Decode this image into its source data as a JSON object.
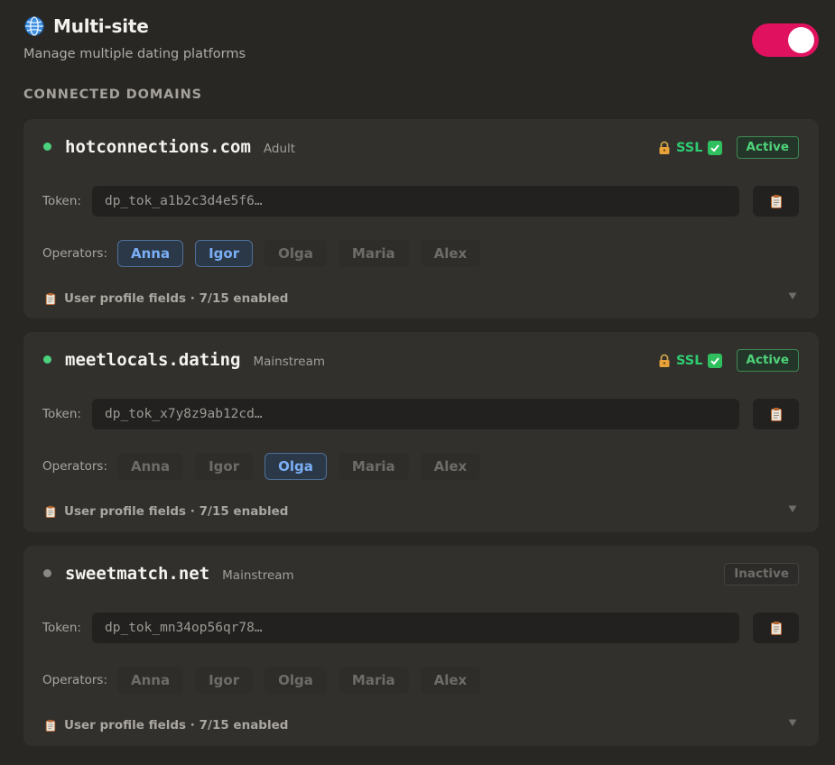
{
  "header": {
    "title": "Multi-site",
    "subtitle": "Manage multiple dating platforms",
    "toggle_on": true
  },
  "section_label": "CONNECTED DOMAINS",
  "domains": [
    {
      "name": "hotconnections.com",
      "category": "Adult",
      "ssl_label": "SSL",
      "ssl": true,
      "status": "Active",
      "token_label": "Token:",
      "token": "dp_tok_a1b2c3d4e5f6…",
      "operators_label": "Operators:",
      "operators": [
        {
          "name": "Anna",
          "selected": true
        },
        {
          "name": "Igor",
          "selected": true
        },
        {
          "name": "Olga",
          "selected": false
        },
        {
          "name": "Maria",
          "selected": false
        },
        {
          "name": "Alex",
          "selected": false
        }
      ],
      "profile_fields": "User profile fields · 7/15 enabled"
    },
    {
      "name": "meetlocals.dating",
      "category": "Mainstream",
      "ssl_label": "SSL",
      "ssl": true,
      "status": "Active",
      "token_label": "Token:",
      "token": "dp_tok_x7y8z9ab12cd…",
      "operators_label": "Operators:",
      "operators": [
        {
          "name": "Anna",
          "selected": false
        },
        {
          "name": "Igor",
          "selected": false
        },
        {
          "name": "Olga",
          "selected": true
        },
        {
          "name": "Maria",
          "selected": false
        },
        {
          "name": "Alex",
          "selected": false
        }
      ],
      "profile_fields": "User profile fields · 7/15 enabled"
    },
    {
      "name": "sweetmatch.net",
      "category": "Mainstream",
      "ssl_label": "",
      "ssl": false,
      "status": "Inactive",
      "token_label": "Token:",
      "token": "dp_tok_mn34op56qr78…",
      "operators_label": "Operators:",
      "operators": [
        {
          "name": "Anna",
          "selected": false
        },
        {
          "name": "Igor",
          "selected": false
        },
        {
          "name": "Olga",
          "selected": false
        },
        {
          "name": "Maria",
          "selected": false
        },
        {
          "name": "Alex",
          "selected": false
        }
      ],
      "profile_fields": "User profile fields · 7/15 enabled"
    }
  ],
  "colors": {
    "accent": "#e0115f",
    "active_green": "#4fd37a",
    "operator_selected": "#7aaef5"
  },
  "icons": {
    "title": "globe-icon",
    "ssl": "lock-icon",
    "ssl_check": "check-icon",
    "copy": "clipboard-icon",
    "profile_fields": "clipboard-icon",
    "expand": "chevron-down-icon"
  }
}
